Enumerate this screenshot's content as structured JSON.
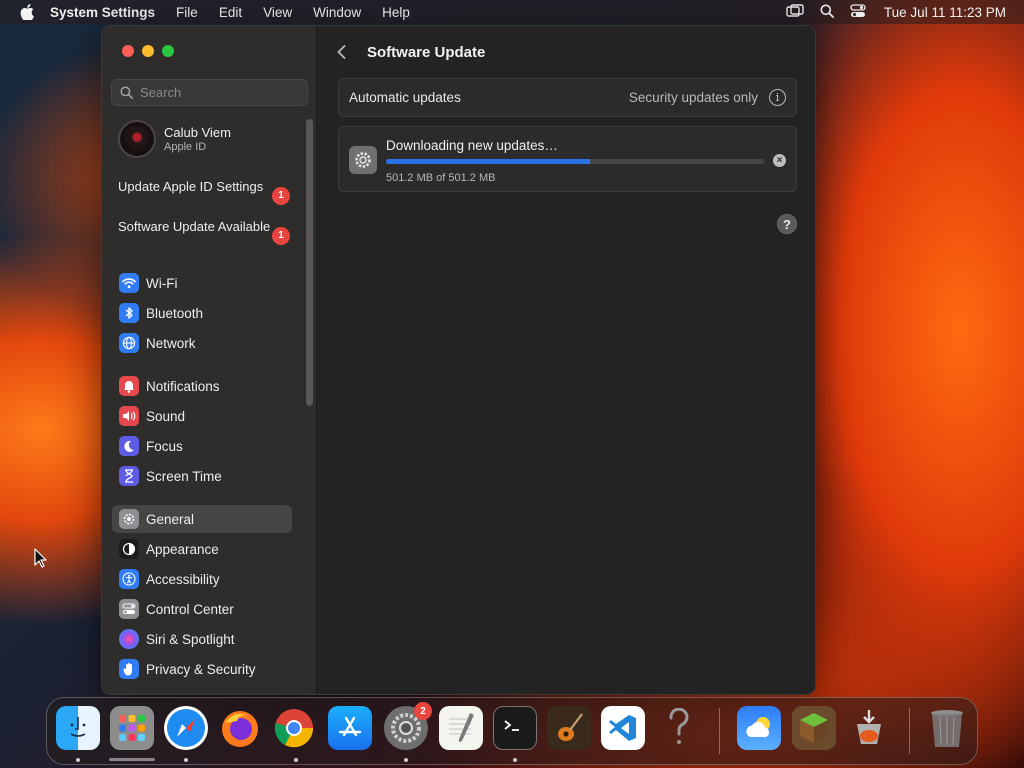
{
  "menubar": {
    "app_name": "System Settings",
    "menus": [
      "File",
      "Edit",
      "View",
      "Window",
      "Help"
    ],
    "clock": "Tue Jul 11  11:23 PM",
    "icons": [
      "apple-icon",
      "screen-mirroring-icon",
      "spotlight-search-icon",
      "control-center-icon"
    ]
  },
  "sidebar": {
    "search_placeholder": "Search",
    "profile": {
      "name": "Calub Viem",
      "subtitle": "Apple ID"
    },
    "notices": [
      {
        "label": "Update Apple ID Settings",
        "badge": "1"
      },
      {
        "label": "Software Update Available",
        "badge": "1"
      }
    ],
    "items": [
      {
        "label": "Wi-Fi",
        "icon": "wifi-icon",
        "color": "#2f7cf6"
      },
      {
        "label": "Bluetooth",
        "icon": "bluetooth-icon",
        "color": "#2f7cf6"
      },
      {
        "label": "Network",
        "icon": "network-globe-icon",
        "color": "#2f7cf6"
      },
      {
        "label": "Notifications",
        "icon": "notifications-bell-icon",
        "color": "#e5484d"
      },
      {
        "label": "Sound",
        "icon": "sound-speaker-icon",
        "color": "#e5484d"
      },
      {
        "label": "Focus",
        "icon": "focus-moon-icon",
        "color": "#5e5ce6"
      },
      {
        "label": "Screen Time",
        "icon": "screen-time-hourglass-icon",
        "color": "#5e5ce6"
      },
      {
        "label": "General",
        "icon": "general-gear-icon",
        "color": "#8e8e93",
        "selected": true
      },
      {
        "label": "Appearance",
        "icon": "appearance-icon",
        "color": "#1c1c1e"
      },
      {
        "label": "Accessibility",
        "icon": "accessibility-icon",
        "color": "#2f7cf6"
      },
      {
        "label": "Control Center",
        "icon": "control-center-toggle-icon",
        "color": "#8e8e93"
      },
      {
        "label": "Siri & Spotlight",
        "icon": "siri-icon",
        "color": "#bf5af2"
      },
      {
        "label": "Privacy & Security",
        "icon": "privacy-hand-icon",
        "color": "#2f7cf6"
      }
    ]
  },
  "main": {
    "title": "Software Update",
    "automatic_updates": {
      "label": "Automatic updates",
      "value": "Security updates only"
    },
    "download": {
      "status": "Downloading new updates…",
      "size_text": "501.2 MB of 501.2 MB",
      "progress_fraction": 0.54
    }
  },
  "dock": {
    "apps": [
      {
        "name": "Finder",
        "icon": "finder-icon",
        "running": true
      },
      {
        "name": "Launchpad",
        "icon": "launchpad-icon",
        "running": false
      },
      {
        "name": "Safari",
        "icon": "safari-icon",
        "running": true
      },
      {
        "name": "Firefox",
        "icon": "firefox-icon",
        "running": false
      },
      {
        "name": "Google Chrome",
        "icon": "chrome-icon",
        "running": true
      },
      {
        "name": "App Store",
        "icon": "app-store-icon",
        "running": false
      },
      {
        "name": "System Settings",
        "icon": "system-settings-icon",
        "running": true,
        "badge": "2"
      },
      {
        "name": "TextEdit",
        "icon": "textedit-icon",
        "running": false
      },
      {
        "name": "Terminal",
        "icon": "terminal-icon",
        "running": true
      },
      {
        "name": "GarageBand",
        "icon": "garageband-icon",
        "running": false
      },
      {
        "name": "Visual Studio Code",
        "icon": "vscode-icon",
        "running": false
      },
      {
        "name": "Help",
        "icon": "question-mark-icon",
        "running": false
      },
      {
        "name": "Weather",
        "icon": "weather-icon",
        "running": false
      },
      {
        "name": "Minecraft",
        "icon": "minecraft-icon",
        "running": false
      },
      {
        "name": "Installer",
        "icon": "installer-icon",
        "running": false
      },
      {
        "name": "Trash",
        "icon": "trash-icon",
        "running": false
      }
    ]
  }
}
